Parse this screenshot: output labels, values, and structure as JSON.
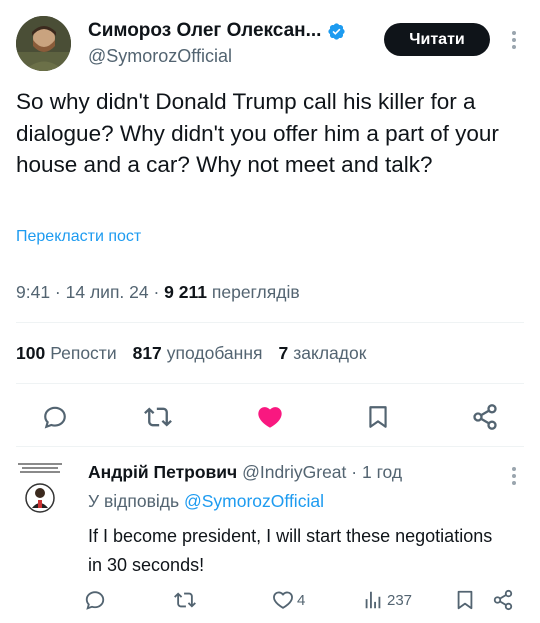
{
  "post": {
    "author_name": "Симороз Олег Олексан...",
    "author_handle": "@SymorozOfficial",
    "follow_label": "Читати",
    "text": "So why didn't Donald Trump call his killer for a dialogue? Why didn't you offer him a part of your house and a car? Why not meet and talk?",
    "translate_label": "Перекласти пост",
    "time": "9:41",
    "sep1": " · ",
    "date": "14 лип. 24",
    "sep2": " · ",
    "views_count": "9 211",
    "views_label": "переглядів",
    "reposts_count": "100",
    "reposts_label": "Репости",
    "likes_count": "817",
    "likes_label": "уподобання",
    "bookmarks_count": "7",
    "bookmarks_label": "закладок"
  },
  "actions": {
    "icons": [
      "reply-icon",
      "repost-icon",
      "like-icon",
      "bookmark-icon",
      "share-icon"
    ],
    "like_color": "#f91880"
  },
  "reply": {
    "author_name": "Андрій Петрович",
    "author_handle": "@IndriyGreat",
    "sep": " · ",
    "time_ago": "1 год",
    "replying_prefix": "У відповідь",
    "replying_to": "@SymorozOfficial",
    "text": "If I become president, I will start these negotiations in 30 seconds!",
    "likes": "4",
    "views": "237"
  },
  "colors": {
    "accent": "#1d9bf0",
    "secondary_text": "#536471",
    "primary_text": "#0f1419"
  }
}
